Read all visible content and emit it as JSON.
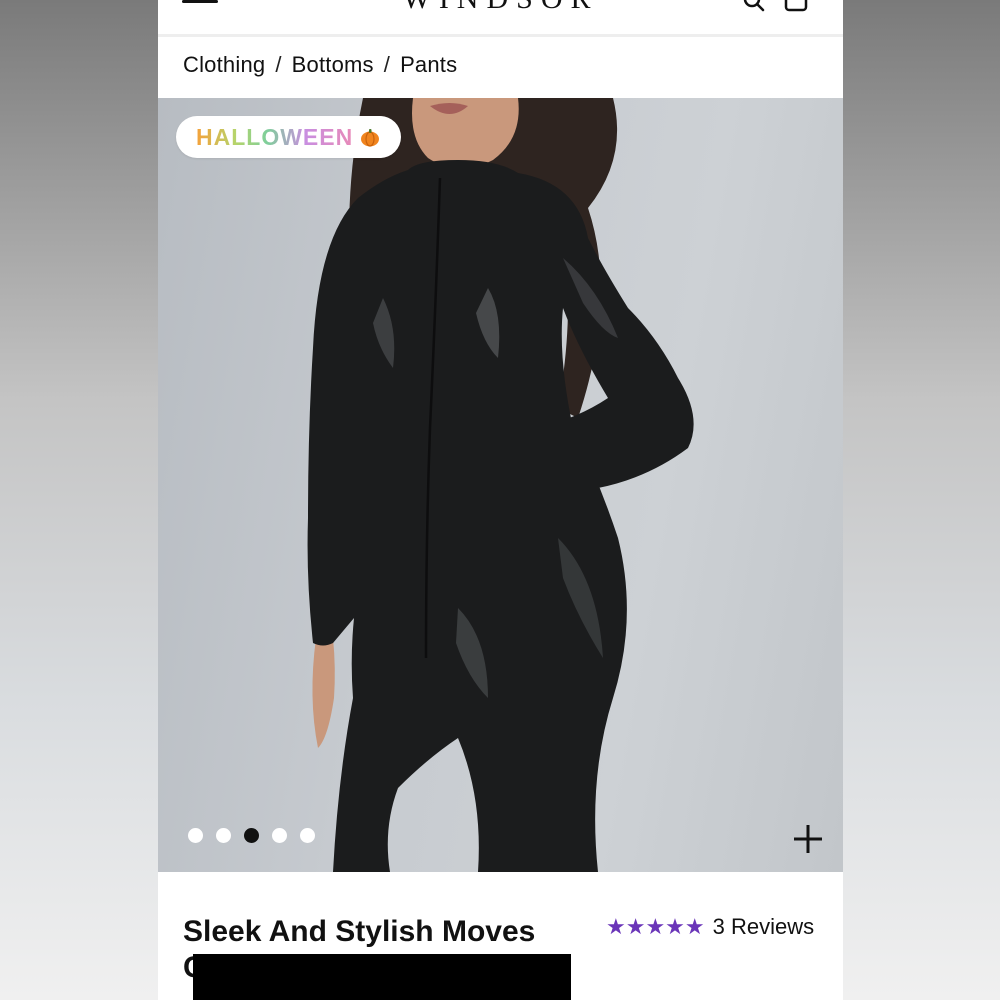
{
  "header": {
    "logo_text": "WINDSOR",
    "menu_icon": "hamburger-menu-icon",
    "search_icon": "search-icon",
    "bag_icon": "shopping-bag-icon"
  },
  "breadcrumb": [
    "Clothing",
    "Bottoms",
    "Pants"
  ],
  "breadcrumb_separator": "/",
  "hero": {
    "badge_text": "HALLOWEEN",
    "badge_icon": "pumpkin-icon",
    "carousel_total": 5,
    "carousel_active_index": 3,
    "zoom_icon": "plus-icon",
    "background_color": "#c6cace"
  },
  "product": {
    "title": "Sleek And Stylish Moves Catsuit",
    "rating_stars": 5,
    "reviews_text": "3 Reviews",
    "star_color": "#6a35b8"
  }
}
